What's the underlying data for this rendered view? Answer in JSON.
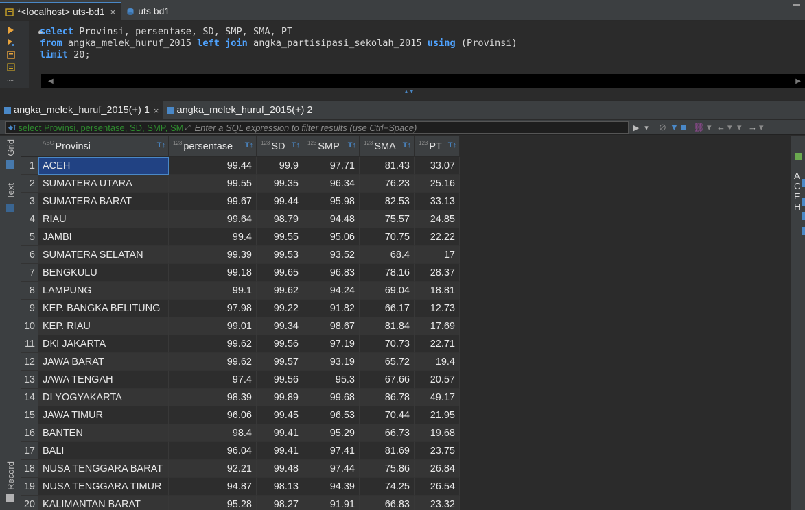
{
  "colors": {
    "accent": "#4a88c7",
    "keyword": "#4fa3ff",
    "selection": "#214283",
    "filter_prefix": "#2e8b2e"
  },
  "editor_tabs": [
    {
      "label": "*<localhost> uts-bd1",
      "close": "×",
      "icon": "sql-editor-icon"
    },
    {
      "label": "uts bd1",
      "icon": "database-icon"
    }
  ],
  "editor": {
    "lines": [
      [
        {
          "t": "kw",
          "v": "select"
        },
        {
          "t": "id",
          "v": " Provinsi, persentase, SD, SMP, SMA, PT"
        }
      ],
      [
        {
          "t": "kw",
          "v": "from"
        },
        {
          "t": "id",
          "v": " angka_melek_huruf_2015 "
        },
        {
          "t": "kw",
          "v": "left join"
        },
        {
          "t": "id",
          "v": " angka_partisipasi_sekolah_2015 "
        },
        {
          "t": "kw",
          "v": "using"
        },
        {
          "t": "id",
          "v": " (Provinsi)"
        }
      ],
      [
        {
          "t": "kw",
          "v": "limit"
        },
        {
          "t": "num",
          "v": " 20"
        },
        {
          "t": "id",
          "v": ";"
        }
      ]
    ]
  },
  "result_tabs": [
    {
      "label": "angka_melek_huruf_2015(+) 1",
      "close": "×"
    },
    {
      "label": "angka_melek_huruf_2015(+) 2"
    }
  ],
  "filter": {
    "prefix": "select Provinsi, persentase, SD, SMP, SM",
    "placeholder": "Enter a SQL expression to filter results (use Ctrl+Space)"
  },
  "side_tabs": {
    "grid": "Grid",
    "text": "Text",
    "record": "Record"
  },
  "right_panel_letters": [
    "A",
    "C",
    "E",
    "H"
  ],
  "grid": {
    "type_tag_text": "ABC",
    "type_tag_num": "123",
    "columns": [
      "Provinsi",
      "persentase",
      "SD",
      "SMP",
      "SMA",
      "PT"
    ],
    "rows": [
      [
        "1",
        "ACEH",
        "99.44",
        "99.9",
        "97.71",
        "81.43",
        "33.07"
      ],
      [
        "2",
        "SUMATERA UTARA",
        "99.55",
        "99.35",
        "96.34",
        "76.23",
        "25.16"
      ],
      [
        "3",
        "SUMATERA BARAT",
        "99.67",
        "99.44",
        "95.98",
        "82.53",
        "33.13"
      ],
      [
        "4",
        "RIAU",
        "99.64",
        "98.79",
        "94.48",
        "75.57",
        "24.85"
      ],
      [
        "5",
        "JAMBI",
        "99.4",
        "99.55",
        "95.06",
        "70.75",
        "22.22"
      ],
      [
        "6",
        "SUMATERA SELATAN",
        "99.39",
        "99.53",
        "93.52",
        "68.4",
        "17"
      ],
      [
        "7",
        "BENGKULU",
        "99.18",
        "99.65",
        "96.83",
        "78.16",
        "28.37"
      ],
      [
        "8",
        "LAMPUNG",
        "99.1",
        "99.62",
        "94.24",
        "69.04",
        "18.81"
      ],
      [
        "9",
        "KEP. BANGKA BELITUNG",
        "97.98",
        "99.22",
        "91.82",
        "66.17",
        "12.73"
      ],
      [
        "10",
        "KEP. RIAU",
        "99.01",
        "99.34",
        "98.67",
        "81.84",
        "17.69"
      ],
      [
        "11",
        "DKI JAKARTA",
        "99.62",
        "99.56",
        "97.19",
        "70.73",
        "22.71"
      ],
      [
        "12",
        "JAWA BARAT",
        "99.62",
        "99.57",
        "93.19",
        "65.72",
        "19.4"
      ],
      [
        "13",
        "JAWA TENGAH",
        "97.4",
        "99.56",
        "95.3",
        "67.66",
        "20.57"
      ],
      [
        "14",
        "DI YOGYAKARTA",
        "98.39",
        "99.89",
        "99.68",
        "86.78",
        "49.17"
      ],
      [
        "15",
        "JAWA TIMUR",
        "96.06",
        "99.45",
        "96.53",
        "70.44",
        "21.95"
      ],
      [
        "16",
        "BANTEN",
        "98.4",
        "99.41",
        "95.29",
        "66.73",
        "19.68"
      ],
      [
        "17",
        "BALI",
        "96.04",
        "99.41",
        "97.41",
        "81.69",
        "23.75"
      ],
      [
        "18",
        "NUSA TENGGARA BARAT",
        "92.21",
        "99.48",
        "97.44",
        "75.86",
        "26.84"
      ],
      [
        "19",
        "NUSA TENGGARA TIMUR",
        "94.87",
        "98.13",
        "94.39",
        "74.25",
        "26.54"
      ],
      [
        "20",
        "KALIMANTAN BARAT",
        "95.28",
        "98.27",
        "91.91",
        "66.83",
        "23.32"
      ]
    ]
  }
}
